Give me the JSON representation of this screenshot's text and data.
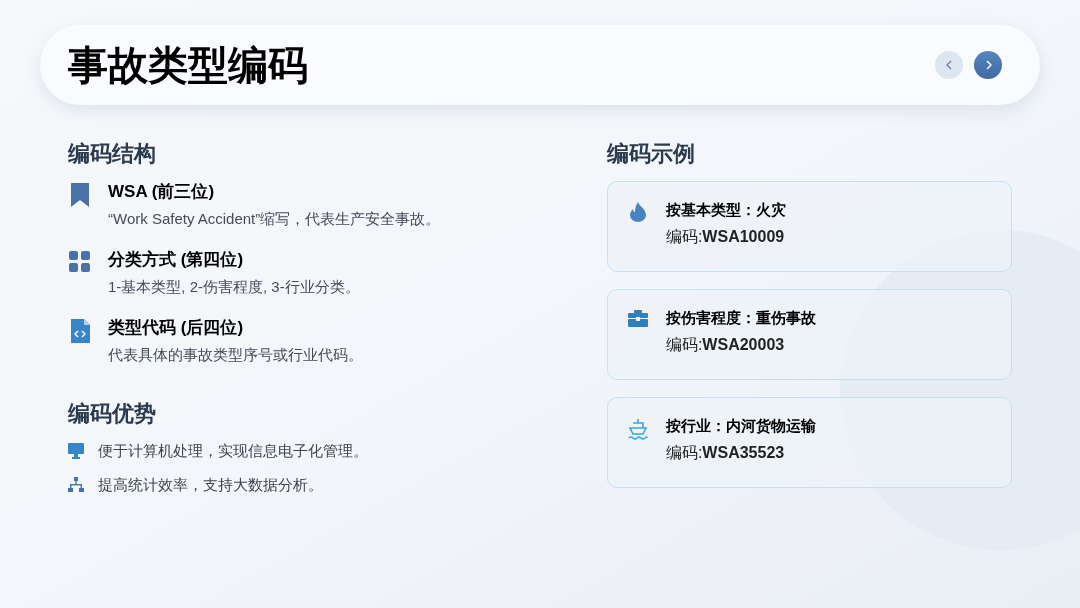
{
  "header": {
    "title": "事故类型编码",
    "nav": [
      {
        "kind": "prev",
        "active": false
      },
      {
        "kind": "next",
        "active": true
      }
    ]
  },
  "structure": {
    "heading": "编码结构",
    "items": [
      {
        "kind": "bookmark",
        "title": "WSA (前三位)",
        "description": "“Work Safety Accident”缩写，代表生产安全事故。"
      },
      {
        "kind": "grid",
        "title": "分类方式 (第四位)",
        "description": "1-基本类型, 2-伤害程度, 3-行业分类。"
      },
      {
        "kind": "code-file",
        "title": "类型代码 (后四位)",
        "description": "代表具体的事故类型序号或行业代码。"
      }
    ]
  },
  "advantages": {
    "heading": "编码优势",
    "items": [
      {
        "kind": "monitor",
        "text": "便于计算机处理，实现信息电子化管理。"
      },
      {
        "kind": "hierarchy",
        "text": "提高统计效率，支持大数据分析。"
      }
    ]
  },
  "examples": {
    "heading": "编码示例",
    "cards": [
      {
        "kind": "flame",
        "title": "按基本类型：火灾",
        "code": "编码:**WSA10009**"
      },
      {
        "kind": "toolbox",
        "title": "按伤害程度：重伤事故",
        "code": "编码:**WSA20003**"
      },
      {
        "kind": "ship",
        "title": "按行业：内河货物运输",
        "code": "编码:**WSA35523**"
      }
    ]
  }
}
